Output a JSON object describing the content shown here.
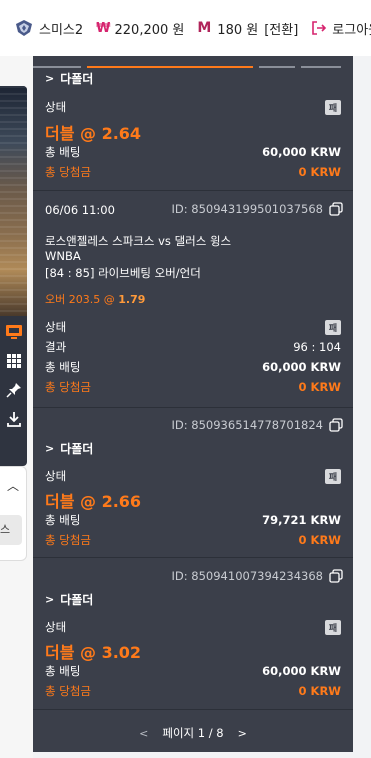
{
  "topbar": {
    "username": "스미스2",
    "won_symbol": "₩",
    "balance": "220,200 원",
    "m_symbol": "M",
    "points": "180 원",
    "switch_label": "[전환]",
    "logout_label": "로그아웃"
  },
  "left": {
    "tag": "스"
  },
  "tickets": [
    {
      "folder_label": "다폴더",
      "status_label": "상태",
      "status_value": "패",
      "odds": "더블 @ 2.64",
      "total_bet_label": "총 배팅",
      "total_bet": "60,000 KRW",
      "win_label": "총 당첨금",
      "win": "0 KRW"
    },
    {
      "date": "06/06 11:00",
      "id": "ID: 850943199501037568",
      "match": "로스앤젤레스 스파크스 vs 댈러스 윙스",
      "league": "WNBA",
      "market": "[84 : 85] 라이브베팅 오버/언더",
      "pick": "오버 203.5 @",
      "pick_odds": "1.79",
      "status_label": "상태",
      "status_value": "패",
      "result_label": "결과",
      "result_value": "96 : 104",
      "total_bet_label": "총 배팅",
      "total_bet": "60,000 KRW",
      "win_label": "총 당첨금",
      "win": "0 KRW"
    },
    {
      "id": "ID: 850936514778701824",
      "folder_label": "다폴더",
      "status_label": "상태",
      "status_value": "패",
      "odds": "더블 @ 2.66",
      "total_bet_label": "총 배팅",
      "total_bet": "79,721 KRW",
      "win_label": "총 당첨금",
      "win": "0 KRW"
    },
    {
      "id": "ID: 850941007394234368",
      "folder_label": "다폴더",
      "status_label": "상태",
      "status_value": "패",
      "odds": "더블 @ 3.02",
      "total_bet_label": "총 배팅",
      "total_bet": "60,000 KRW",
      "win_label": "총 당첨금",
      "win": "0 KRW"
    }
  ],
  "pager": {
    "prev": "<",
    "label": "페이지 1 / 8",
    "next": ">"
  },
  "colors": {
    "accent": "#ff7a1a",
    "panel": "#3b3f4a",
    "brand": "#d6246e"
  }
}
